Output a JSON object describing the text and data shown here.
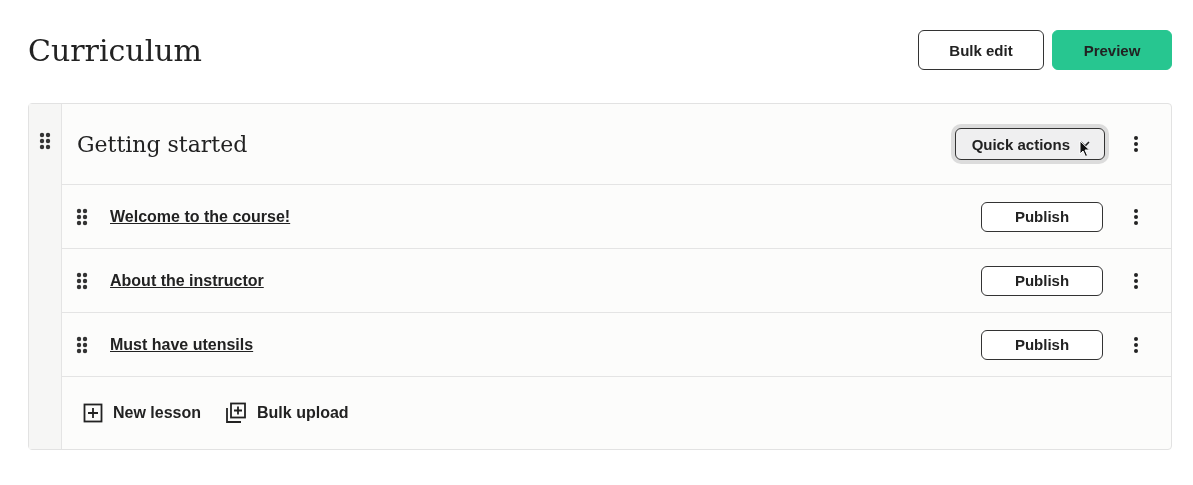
{
  "page": {
    "title": "Curriculum"
  },
  "header_actions": [
    {
      "label": "Bulk edit",
      "kind": "outline"
    },
    {
      "label": "Preview",
      "kind": "primary"
    }
  ],
  "section": {
    "title": "Getting started",
    "quick_actions": {
      "label": "Quick actions",
      "focused": true
    },
    "lessons": [
      {
        "title": "Welcome to the course!",
        "action": "Publish"
      },
      {
        "title": "About the instructor",
        "action": "Publish"
      },
      {
        "title": "Must have utensils",
        "action": "Publish"
      }
    ],
    "footer_actions": [
      {
        "label": "New lesson",
        "kind": "new"
      },
      {
        "label": "Bulk upload",
        "kind": "bulk"
      }
    ]
  }
}
